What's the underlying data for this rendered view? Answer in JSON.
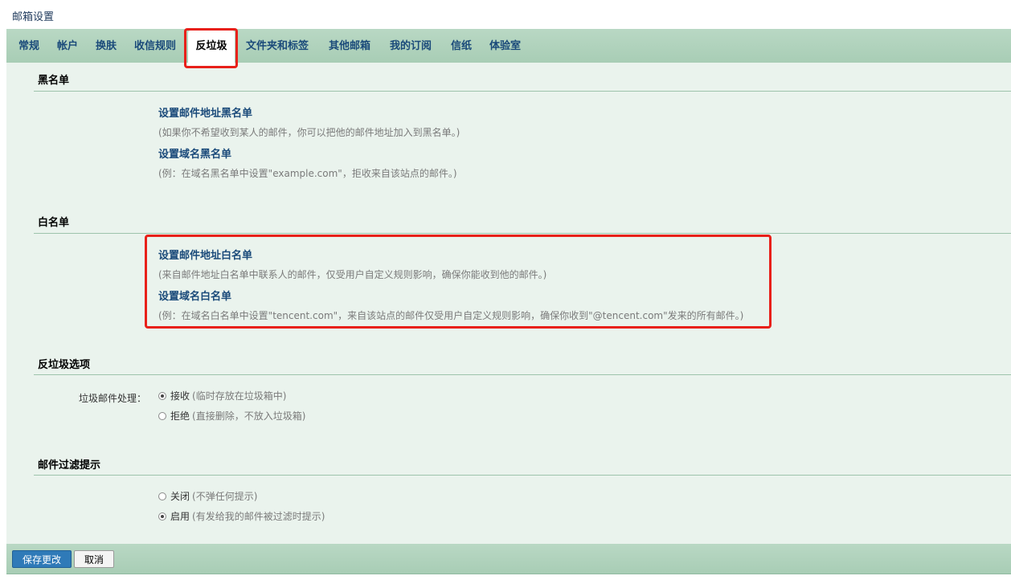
{
  "page": {
    "title": "邮箱设置"
  },
  "tabs": [
    {
      "label": "常规"
    },
    {
      "label": "帐户"
    },
    {
      "label": "换肤"
    },
    {
      "label": "收信规则"
    },
    {
      "label": "反垃圾",
      "active": true
    },
    {
      "label": "文件夹和标签"
    },
    {
      "label": "其他邮箱"
    },
    {
      "label": "我的订阅"
    },
    {
      "label": "信纸"
    },
    {
      "label": "体验室"
    }
  ],
  "blacklist": {
    "title": "黑名单",
    "address_link": "设置邮件地址黑名单",
    "address_desc": "(如果你不希望收到某人的邮件，你可以把他的邮件地址加入到黑名单。)",
    "domain_link": "设置域名黑名单",
    "domain_desc": "(例：在域名黑名单中设置\"example.com\"，拒收来自该站点的邮件。)"
  },
  "whitelist": {
    "title": "白名单",
    "address_link": "设置邮件地址白名单",
    "address_desc": "(来自邮件地址白名单中联系人的邮件，仅受用户自定义规则影响，确保你能收到他的邮件。)",
    "domain_link": "设置域名白名单",
    "domain_desc": "(例：在域名白名单中设置\"tencent.com\"，来自该站点的邮件仅受用户自定义规则影响，确保你收到\"@tencent.com\"发来的所有邮件。)"
  },
  "antispam": {
    "title": "反垃圾选项",
    "label": "垃圾邮件处理：",
    "options": [
      {
        "label": "接收",
        "note": "(临时存放在垃圾箱中)",
        "checked": true
      },
      {
        "label": "拒绝",
        "note": "(直接删除，不放入垃圾箱)",
        "checked": false
      }
    ]
  },
  "filter_tip": {
    "title": "邮件过滤提示",
    "options": [
      {
        "label": "关闭",
        "note": "(不弹任何提示)",
        "checked": false
      },
      {
        "label": "启用",
        "note": "(有发给我的邮件被过滤时提示)",
        "checked": true
      }
    ]
  },
  "footer": {
    "save_label": "保存更改",
    "cancel_label": "取消"
  },
  "colors": {
    "highlight": "#e8201a",
    "link": "#1a4a7a",
    "tabbar": "#b9d8c4",
    "panel": "#eaf3ed",
    "primary": "#2f7ab8"
  }
}
